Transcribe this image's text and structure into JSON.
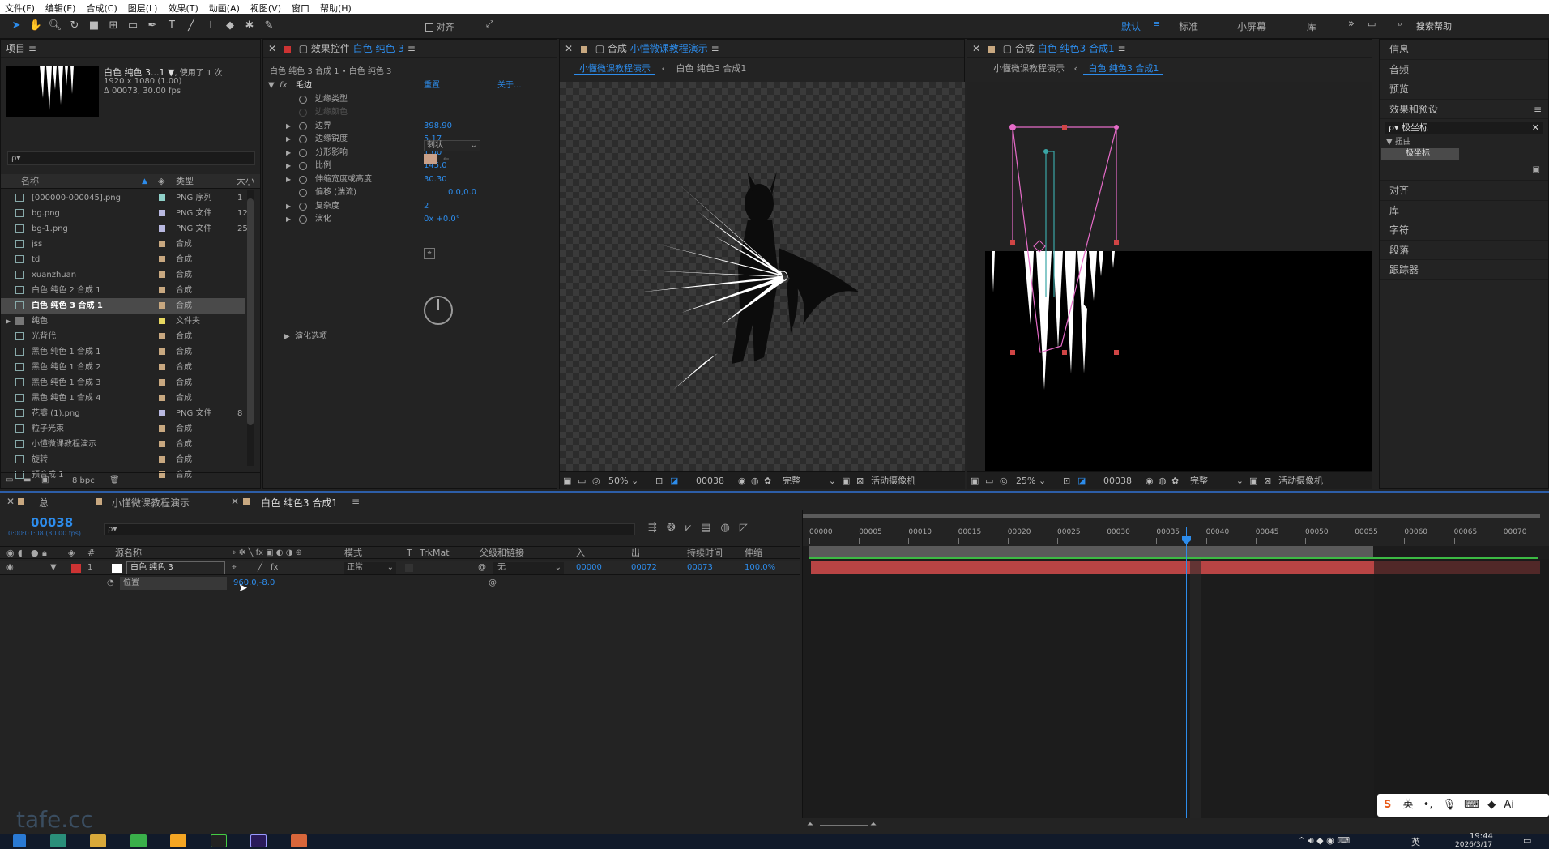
{
  "menu": [
    "文件(F)",
    "编辑(E)",
    "合成(C)",
    "图层(L)",
    "效果(T)",
    "动画(A)",
    "视图(V)",
    "窗口",
    "帮助(H)"
  ],
  "toolbar": {
    "snap_label": "对齐",
    "workspaces": [
      "默认",
      "标准",
      "小屏幕",
      "库"
    ],
    "search_placeholder": "搜索帮助"
  },
  "project": {
    "title": "项目",
    "selected_name": "白色 纯色 3...1 ▼",
    "used": ", 使用了 1 次",
    "dims": "1920 x 1080 (1.00)",
    "duration": "Δ 00073, 30.00 fps",
    "search_placeholder": "ρ▾",
    "col_name": "名称",
    "col_type": "类型",
    "col_size": "大小",
    "items": [
      {
        "name": "[000000-000045].png",
        "type": "PNG 序列",
        "size": "1",
        "color": "#8fd0c8"
      },
      {
        "name": "bg.png",
        "type": "PNG 文件",
        "size": "12",
        "color": "#b8b8e0"
      },
      {
        "name": "bg-1.png",
        "type": "PNG 文件",
        "size": "25",
        "color": "#b8b8e0"
      },
      {
        "name": "jss",
        "type": "合成",
        "size": "",
        "color": "#c8a880"
      },
      {
        "name": "td",
        "type": "合成",
        "size": "",
        "color": "#c8a880"
      },
      {
        "name": "xuanzhuan",
        "type": "合成",
        "size": "",
        "color": "#c8a880"
      },
      {
        "name": "白色 纯色 2 合成 1",
        "type": "合成",
        "size": "",
        "color": "#c8a880"
      },
      {
        "name": "白色 纯色 3 合成 1",
        "type": "合成",
        "size": "",
        "color": "#c8a880"
      },
      {
        "name": "纯色",
        "type": "文件夹",
        "size": "",
        "color": "#e8d860"
      },
      {
        "name": "光背代",
        "type": "合成",
        "size": "",
        "color": "#c8a880"
      },
      {
        "name": "黑色 纯色 1 合成 1",
        "type": "合成",
        "size": "",
        "color": "#c8a880"
      },
      {
        "name": "黑色 纯色 1 合成 2",
        "type": "合成",
        "size": "",
        "color": "#c8a880"
      },
      {
        "name": "黑色 纯色 1 合成 3",
        "type": "合成",
        "size": "",
        "color": "#c8a880"
      },
      {
        "name": "黑色 纯色 1 合成 4",
        "type": "合成",
        "size": "",
        "color": "#c8a880"
      },
      {
        "name": "花瓣 (1).png",
        "type": "PNG 文件",
        "size": "8",
        "color": "#b8b8e0"
      },
      {
        "name": "粒子光束",
        "type": "合成",
        "size": "",
        "color": "#c8a880"
      },
      {
        "name": "小懂微课教程演示",
        "type": "合成",
        "size": "",
        "color": "#c8a880"
      },
      {
        "name": "旋转",
        "type": "合成",
        "size": "",
        "color": "#c8a880"
      },
      {
        "name": "预合成 1",
        "type": "合成",
        "size": "",
        "color": "#c8a880"
      }
    ],
    "bpc": "8 bpc"
  },
  "effects": {
    "title": "效果控件",
    "layer": "白色 纯色 3",
    "breadcrumb": "白色 纯色 3 合成 1 • 白色 纯色 3",
    "fx_name": "毛边",
    "reset": "重置",
    "about": "关于...",
    "props": [
      {
        "name": "边缘类型",
        "value": "刺状",
        "arrow": false
      },
      {
        "name": "边缘颜色",
        "value": "",
        "arrow": false
      },
      {
        "name": "边界",
        "value": "398.90",
        "arrow": true
      },
      {
        "name": "边缘锐度",
        "value": "5.17",
        "arrow": true
      },
      {
        "name": "分形影响",
        "value": "1.00",
        "arrow": true
      },
      {
        "name": "比例",
        "value": "145.0",
        "arrow": true
      },
      {
        "name": "伸缩宽度或高度",
        "value": "30.30",
        "arrow": true
      },
      {
        "name": "偏移 (湍流)",
        "value": "0.0,0.0",
        "arrow": false
      },
      {
        "name": "复杂度",
        "value": "2",
        "arrow": true
      },
      {
        "name": "演化",
        "value": "0x +0.0°",
        "arrow": true
      }
    ],
    "evo_options": "演化选项"
  },
  "comp1": {
    "title": "合成",
    "name": "小懂微课教程演示",
    "tabs": [
      "小懂微课教程演示",
      "白色 纯色3 合成1"
    ],
    "zoom": "50%",
    "frame": "00038",
    "quality": "完整",
    "camera": "活动摄像机"
  },
  "comp2": {
    "title": "合成",
    "name": "白色 纯色3 合成1",
    "tabs": [
      "小懂微课教程演示",
      "白色 纯色3 合成1"
    ],
    "zoom": "25%",
    "frame": "00038",
    "quality": "完整",
    "camera": "活动摄像机"
  },
  "right": {
    "top": [
      "信息",
      "音频",
      "预览"
    ],
    "effects_presets": "效果和预设",
    "search_value": "极坐标",
    "category": "扭曲",
    "result": "极坐标",
    "bottom": [
      "对齐",
      "库",
      "字符",
      "段落",
      "跟踪器"
    ]
  },
  "timeline": {
    "tabs": [
      "总",
      "小懂微课教程演示",
      "白色 纯色3 合成1"
    ],
    "timecode": "00038",
    "fps_note": "0:00:01:08 (30.00 fps)",
    "search_placeholder": "ρ▾",
    "headers": {
      "num": "#",
      "source": "源名称",
      "mode": "模式",
      "t": "T",
      "trkmat": "TrkMat",
      "parent": "父级和链接",
      "in": "入",
      "out": "出",
      "duration": "持续时间",
      "stretch": "伸缩"
    },
    "layer": {
      "num": "1",
      "name": "白色 纯色 3",
      "mode": "正常",
      "parent": "无",
      "in": "00000",
      "out": "00072",
      "duration": "00073",
      "stretch": "100.0%"
    },
    "prop": {
      "name": "位置",
      "value": "960.0,-8.0"
    },
    "ruler": [
      "00000",
      "00005",
      "00010",
      "00015",
      "00020",
      "00025",
      "00030",
      "00035",
      "00040",
      "00045",
      "00050",
      "00055",
      "00060",
      "00065",
      "00070"
    ]
  },
  "ime": {
    "lang": "英"
  },
  "taskbar": {
    "time": "19:44",
    "date": "2026/3/17",
    "lang": "英"
  },
  "watermark": "tafe.cc"
}
